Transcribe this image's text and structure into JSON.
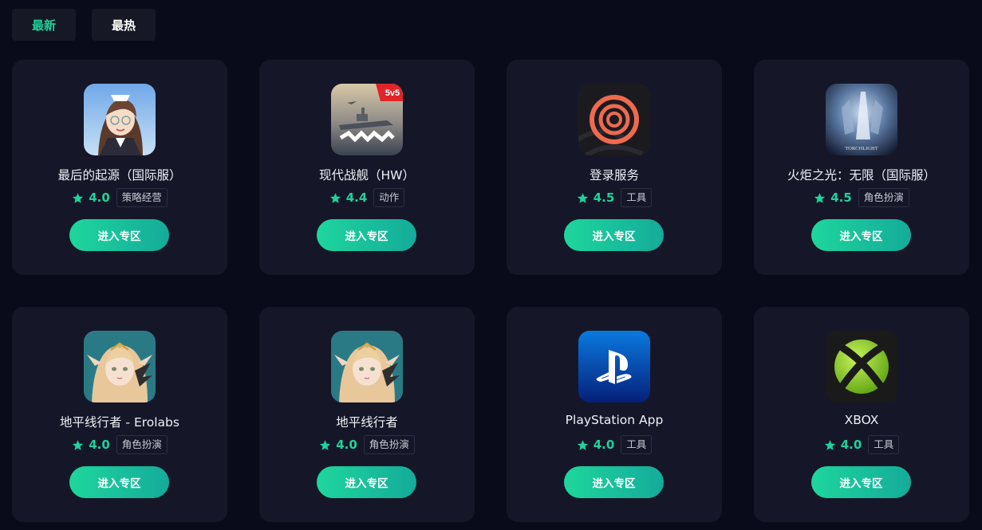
{
  "tabs": [
    {
      "label": "最新",
      "active": true
    },
    {
      "label": "最热",
      "active": false
    }
  ],
  "button_label": "进入专区",
  "accent_color": "#1ed39a",
  "apps": [
    {
      "name": "最后的起源（国际服）",
      "rating": "4.0",
      "tag": "策略经营",
      "icon": "anime-maid-girl-icon"
    },
    {
      "name": "现代战舰（HW）",
      "rating": "4.4",
      "tag": "动作",
      "icon": "modern-warships-icon",
      "badge": "5v5"
    },
    {
      "name": "登录服务",
      "rating": "4.5",
      "tag": "工具",
      "icon": "concentric-rings-icon"
    },
    {
      "name": "火炬之光：无限（国际服）",
      "rating": "4.5",
      "tag": "角色扮演",
      "icon": "torchlight-icon",
      "icon_text": "TORCHLIGHT"
    },
    {
      "name": "地平线行者 - Erolabs",
      "rating": "4.0",
      "tag": "角色扮演",
      "icon": "elf-girl-icon"
    },
    {
      "name": "地平线行者",
      "rating": "4.0",
      "tag": "角色扮演",
      "icon": "elf-girl-icon"
    },
    {
      "name": "PlayStation App",
      "rating": "4.0",
      "tag": "工具",
      "icon": "playstation-icon"
    },
    {
      "name": "XBOX",
      "rating": "4.0",
      "tag": "工具",
      "icon": "xbox-icon"
    }
  ]
}
